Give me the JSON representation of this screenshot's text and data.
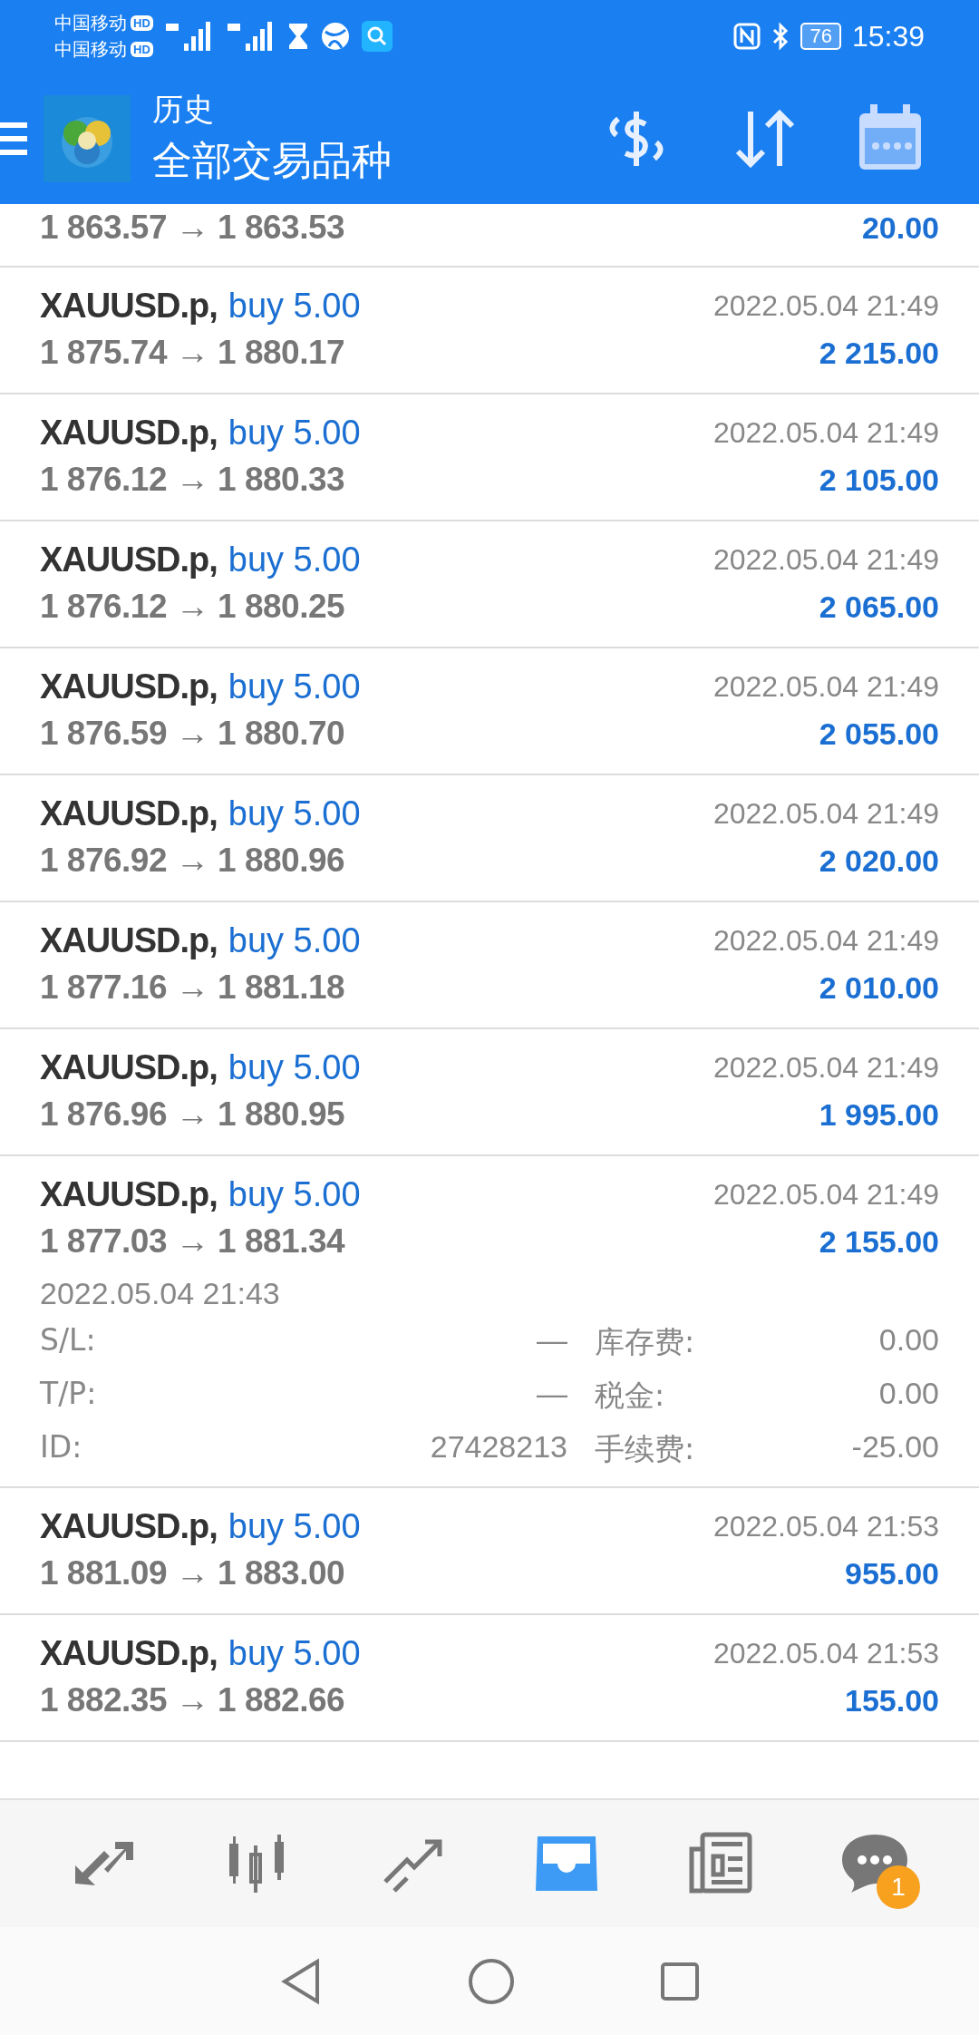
{
  "status_bar": {
    "carriers": [
      {
        "name": "中国移动",
        "badge": "HD"
      },
      {
        "name": "中国移动",
        "badge": "HD"
      }
    ],
    "battery": "76",
    "time": "15:39"
  },
  "header": {
    "title": "历史",
    "subtitle": "全部交易品种"
  },
  "trades": [
    {
      "prices": "1 863.57 → 1 863.53",
      "profit": "20.00",
      "expanded": false
    },
    {
      "symbol": "XAUUSD.p,",
      "side": "buy 5.00",
      "date": "2022.05.04 21:49",
      "prices": "1 875.74 → 1 880.17",
      "profit": "2 215.00",
      "expanded": false
    },
    {
      "symbol": "XAUUSD.p,",
      "side": "buy 5.00",
      "date": "2022.05.04 21:49",
      "prices": "1 876.12 → 1 880.33",
      "profit": "2 105.00",
      "expanded": false
    },
    {
      "symbol": "XAUUSD.p,",
      "side": "buy 5.00",
      "date": "2022.05.04 21:49",
      "prices": "1 876.12 → 1 880.25",
      "profit": "2 065.00",
      "expanded": false
    },
    {
      "symbol": "XAUUSD.p,",
      "side": "buy 5.00",
      "date": "2022.05.04 21:49",
      "prices": "1 876.59 → 1 880.70",
      "profit": "2 055.00",
      "expanded": false
    },
    {
      "symbol": "XAUUSD.p,",
      "side": "buy 5.00",
      "date": "2022.05.04 21:49",
      "prices": "1 876.92 → 1 880.96",
      "profit": "2 020.00",
      "expanded": false
    },
    {
      "symbol": "XAUUSD.p,",
      "side": "buy 5.00",
      "date": "2022.05.04 21:49",
      "prices": "1 877.16 → 1 881.18",
      "profit": "2 010.00",
      "expanded": false
    },
    {
      "symbol": "XAUUSD.p,",
      "side": "buy 5.00",
      "date": "2022.05.04 21:49",
      "prices": "1 876.96 → 1 880.95",
      "profit": "1 995.00",
      "expanded": false
    },
    {
      "symbol": "XAUUSD.p,",
      "side": "buy 5.00",
      "date": "2022.05.04 21:49",
      "prices": "1 877.03 → 1 881.34",
      "profit": "2 155.00",
      "expanded": true,
      "open_time": "2022.05.04 21:43",
      "details": [
        {
          "label": "S/L:",
          "value": "—",
          "label2": "库存费:",
          "value2": "0.00"
        },
        {
          "label": "T/P:",
          "value": "—",
          "label2": "税金:",
          "value2": "0.00"
        },
        {
          "label": "ID:",
          "value": "27428213",
          "label2": "手续费:",
          "value2": "-25.00"
        }
      ]
    },
    {
      "symbol": "XAUUSD.p,",
      "side": "buy 5.00",
      "date": "2022.05.04 21:53",
      "prices": "1 881.09 → 1 883.00",
      "profit": "955.00",
      "expanded": false
    },
    {
      "symbol": "XAUUSD.p,",
      "side": "buy 5.00",
      "date": "2022.05.04 21:53",
      "prices": "1 882.35 → 1 882.66",
      "profit": "155.00",
      "expanded": false
    }
  ],
  "bottom_nav": [
    {
      "kind": "quotes",
      "selected": false
    },
    {
      "kind": "chart",
      "selected": false
    },
    {
      "kind": "trade",
      "selected": false
    },
    {
      "kind": "history",
      "selected": true
    },
    {
      "kind": "news",
      "selected": false
    },
    {
      "kind": "chat",
      "selected": false,
      "badge": "1"
    }
  ]
}
